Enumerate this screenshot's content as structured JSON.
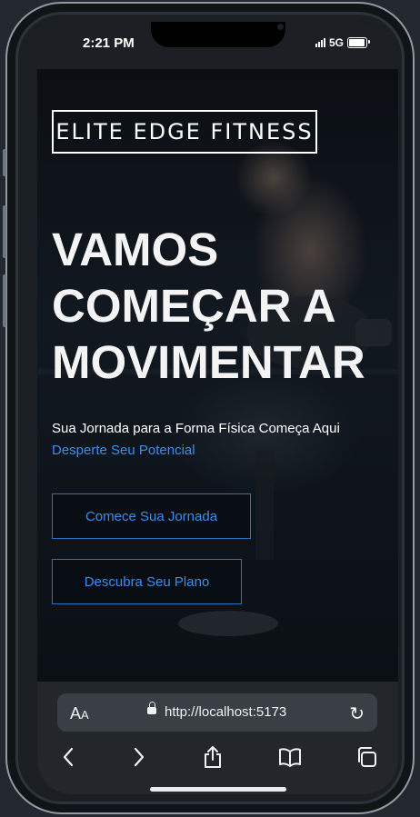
{
  "status": {
    "time": "2:21 PM",
    "network": "5G"
  },
  "hero": {
    "brand": "ELITE EDGE FITNESS",
    "headline": [
      "VAMOS",
      "COMEÇAR A",
      "MOVIMENTAR"
    ],
    "subtitle": "Sua Jornada para a Forma Física Começa Aqui",
    "tagline": "Desperte Seu Potencial",
    "primary_button": "Comece Sua Jornada",
    "secondary_button": "Descubra Seu Plano"
  },
  "browser": {
    "text_size_label": "A",
    "text_size_small": "A",
    "url": "http://localhost:5173",
    "icons": [
      "lock-icon",
      "reload-icon",
      "back-icon",
      "forward-icon",
      "share-icon",
      "bookmarks-icon",
      "tabs-icon"
    ]
  },
  "colors": {
    "accent": "#3b8eea",
    "background": "#0d1116",
    "browser_bar": "#23272c"
  }
}
